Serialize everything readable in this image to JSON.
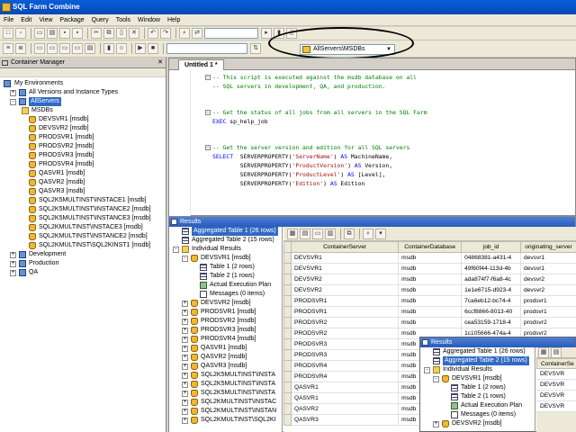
{
  "window": {
    "title": "SQL Farm Combine"
  },
  "menu": [
    "File",
    "Edit",
    "View",
    "Package",
    "Query",
    "Tools",
    "Window",
    "Help"
  ],
  "toolbar": {
    "server_combo": "AllServers\\MSDBs"
  },
  "container_manager": {
    "title": "Container Manager",
    "root": "My Environments",
    "items": [
      {
        "label": "All Versions and Instance Types",
        "level": 1,
        "icon": "env"
      },
      {
        "label": "AllServers",
        "level": 1,
        "icon": "env",
        "selected": true
      },
      {
        "label": "MSDBs",
        "level": 2,
        "icon": "folder"
      },
      {
        "label": "DEVSVR1 [msdb]",
        "level": 3,
        "icon": "db"
      },
      {
        "label": "DEVSVR2 [msdb]",
        "level": 3,
        "icon": "db"
      },
      {
        "label": "PRODSVR1 [msdb]",
        "level": 3,
        "icon": "db"
      },
      {
        "label": "PRODSVR2 [msdb]",
        "level": 3,
        "icon": "db"
      },
      {
        "label": "PRODSVR3 [msdb]",
        "level": 3,
        "icon": "db"
      },
      {
        "label": "PRODSVR4 [msdb]",
        "level": 3,
        "icon": "db"
      },
      {
        "label": "QASVR1 [msdb]",
        "level": 3,
        "icon": "db"
      },
      {
        "label": "QASVR2 [msdb]",
        "level": 3,
        "icon": "db"
      },
      {
        "label": "QASVR3 [msdb]",
        "level": 3,
        "icon": "db"
      },
      {
        "label": "SQL2K5MULTINST\\INSTACE1 [msdb]",
        "level": 3,
        "icon": "db"
      },
      {
        "label": "SQL2K5MULTINST\\INSTANCE2 [msdb]",
        "level": 3,
        "icon": "db"
      },
      {
        "label": "SQL2K5MULTINST\\INSTANCE3 [msdb]",
        "level": 3,
        "icon": "db"
      },
      {
        "label": "SQL2KMULTINST\\INSTACE3 [msdb]",
        "level": 3,
        "icon": "db"
      },
      {
        "label": "SQL2KMULTINST\\INSTANCE2 [msdb]",
        "level": 3,
        "icon": "db"
      },
      {
        "label": "SQL2KMULTINST\\SQL2KINST1 [msdb]",
        "level": 3,
        "icon": "db"
      },
      {
        "label": "Development",
        "level": 1,
        "icon": "env"
      },
      {
        "label": "Production",
        "level": 1,
        "icon": "env"
      },
      {
        "label": "QA",
        "level": 1,
        "icon": "env"
      }
    ]
  },
  "editor": {
    "tab": "Untitled 1 *",
    "lines": [
      [
        {
          "t": "-- This script is executed against the msdb database on all",
          "c": "cm"
        }
      ],
      [
        {
          "t": "-- SQL servers in development, QA, and production.",
          "c": "cm"
        }
      ],
      [],
      [],
      [
        {
          "t": "-- Get the status of all jobs from all servers in the SQL Farm",
          "c": "cm"
        }
      ],
      [
        {
          "t": "EXEC ",
          "c": "kw"
        },
        {
          "t": "sp_help_job",
          "c": "fn"
        }
      ],
      [],
      [],
      [
        {
          "t": "-- Get the server version and edition for all SQL servers",
          "c": "cm"
        }
      ],
      [
        {
          "t": "SELECT  ",
          "c": "kw"
        },
        {
          "t": "SERVERPROPERTY(",
          "c": "fn"
        },
        {
          "t": "'ServerName'",
          "c": "st"
        },
        {
          "t": ") ",
          "c": "fn"
        },
        {
          "t": "AS ",
          "c": "kw"
        },
        {
          "t": "MachineName,",
          "c": "fn"
        }
      ],
      [
        {
          "t": "        SERVERPROPERTY(",
          "c": "fn"
        },
        {
          "t": "'ProductVersion'",
          "c": "st"
        },
        {
          "t": ") ",
          "c": "fn"
        },
        {
          "t": "AS ",
          "c": "kw"
        },
        {
          "t": "Version,",
          "c": "fn"
        }
      ],
      [
        {
          "t": "        SERVERPROPERTY(",
          "c": "fn"
        },
        {
          "t": "'ProductLevel'",
          "c": "st"
        },
        {
          "t": ") ",
          "c": "fn"
        },
        {
          "t": "AS ",
          "c": "kw"
        },
        {
          "t": "[Level],",
          "c": "fn"
        }
      ],
      [
        {
          "t": "        SERVERPROPERTY(",
          "c": "fn"
        },
        {
          "t": "'Edition'",
          "c": "st"
        },
        {
          "t": ") ",
          "c": "fn"
        },
        {
          "t": "AS ",
          "c": "kw"
        },
        {
          "t": "Edition",
          "c": "fn"
        }
      ]
    ]
  },
  "results": {
    "title": "Results",
    "tree": [
      {
        "label": "Aggregated Table 1 (26 rows)",
        "level": 0,
        "icon": "table",
        "selected": true
      },
      {
        "label": "Aggregated Table 2 (15 rows)",
        "level": 0,
        "icon": "table"
      },
      {
        "label": "Individual Results",
        "level": 0,
        "icon": "folder",
        "exp": "-"
      },
      {
        "label": "DEVSVR1 [msdb]",
        "level": 1,
        "icon": "db",
        "exp": "-"
      },
      {
        "label": "Table 1 (2 rows)",
        "level": 2,
        "icon": "table"
      },
      {
        "label": "Table 2 (1 rows)",
        "level": 2,
        "icon": "table"
      },
      {
        "label": "Actual Execution Plan",
        "level": 2,
        "icon": "plan"
      },
      {
        "label": "Messages (0 items)",
        "level": 2,
        "icon": "msg"
      },
      {
        "label": "DEVSVR2 [msdb]",
        "level": 1,
        "icon": "db",
        "exp": "+"
      },
      {
        "label": "PRODSVR1 [msdb]",
        "level": 1,
        "icon": "db",
        "exp": "+"
      },
      {
        "label": "PRODSVR2 [msdb]",
        "level": 1,
        "icon": "db",
        "exp": "+"
      },
      {
        "label": "PRODSVR3 [msdb]",
        "level": 1,
        "icon": "db",
        "exp": "+"
      },
      {
        "label": "PRODSVR4 [msdb]",
        "level": 1,
        "icon": "db",
        "exp": "+"
      },
      {
        "label": "QASVR1 [msdb]",
        "level": 1,
        "icon": "db",
        "exp": "+"
      },
      {
        "label": "QASVR2 [msdb]",
        "level": 1,
        "icon": "db",
        "exp": "+"
      },
      {
        "label": "QASVR3 [msdb]",
        "level": 1,
        "icon": "db",
        "exp": "+"
      },
      {
        "label": "SQL2K5MULTINST\\INSTA",
        "level": 1,
        "icon": "db",
        "exp": "+"
      },
      {
        "label": "SQL2K5MULTINST\\INSTA",
        "level": 1,
        "icon": "db",
        "exp": "+"
      },
      {
        "label": "SQL2K5MULTINST\\INSTA",
        "level": 1,
        "icon": "db",
        "exp": "+"
      },
      {
        "label": "SQL2KMULTINST\\INSTAC",
        "level": 1,
        "icon": "db",
        "exp": "+"
      },
      {
        "label": "SQL2KMULTINST\\INSTAN",
        "level": 1,
        "icon": "db",
        "exp": "+"
      },
      {
        "label": "SQL2KMULTINST\\SQL2KI",
        "level": 1,
        "icon": "db",
        "exp": "+"
      }
    ],
    "grid": {
      "columns": [
        "ContainerServer",
        "ContainerDatabase",
        "job_id",
        "originating_server"
      ],
      "rows": [
        [
          "DEVSVR1",
          "msdb",
          "04868381-a431-4",
          "devsvr1"
        ],
        [
          "DEVSVR1",
          "msdb",
          "49f60f44-113d-4b",
          "devsvr1"
        ],
        [
          "DEVSVR2",
          "msdb",
          "ada874f7-f6a8-4c",
          "devsvr2"
        ],
        [
          "DEVSVR2",
          "msdb",
          "1e1e6715-d923-4",
          "devsvr2"
        ],
        [
          "PRODSVR1",
          "msdb",
          "7ca6eb12-bc74-4",
          "prodsvr1"
        ],
        [
          "PRODSVR1",
          "msdb",
          "6ccf8866-8013-40",
          "prodsvr1"
        ],
        [
          "PRODSVR2",
          "msdb",
          "cea53159-1718-4",
          "prodsvr2"
        ],
        [
          "PRODSVR2",
          "msdb",
          "1c105666-474a-4",
          "prodsvr2"
        ],
        [
          "PRODSVR3",
          "msdb",
          "",
          ""
        ],
        [
          "PRODSVR3",
          "msdb",
          "",
          ""
        ],
        [
          "PRODSVR4",
          "msdb",
          "",
          ""
        ],
        [
          "PRODSVR4",
          "msdb",
          "",
          ""
        ],
        [
          "QASVR1",
          "msdb",
          "",
          ""
        ],
        [
          "QASVR1",
          "msdb",
          "",
          ""
        ],
        [
          "QASVR2",
          "msdb",
          "",
          ""
        ],
        [
          "QASVR3",
          "msdb",
          "",
          ""
        ]
      ]
    }
  },
  "floating_results": {
    "title": "Results",
    "tree": [
      {
        "label": "Aggregated Table 1 (26 rows)",
        "level": 0,
        "icon": "table"
      },
      {
        "label": "Aggregated Table 2 (15 rows)",
        "level": 0,
        "icon": "table",
        "selected": true
      },
      {
        "label": "Individual Results",
        "level": 0,
        "icon": "folder",
        "exp": "-"
      },
      {
        "label": "DEVSVR1 [msdb]",
        "level": 1,
        "icon": "db",
        "exp": "-"
      },
      {
        "label": "Table 1 (2 rows)",
        "level": 2,
        "icon": "table"
      },
      {
        "label": "Table 2 (1 rows)",
        "level": 2,
        "icon": "table"
      },
      {
        "label": "Actual Execution Plan",
        "level": 2,
        "icon": "plan"
      },
      {
        "label": "Messages (0 items)",
        "level": 2,
        "icon": "msg"
      },
      {
        "label": "DEVSVR2 [msdb]",
        "level": 1,
        "icon": "db",
        "exp": "+"
      }
    ],
    "grid_header": "ContainerSe",
    "grid_rows": [
      "DEVSVR",
      "DEVSVR",
      "DEVSVR",
      "DEVSVR"
    ]
  }
}
